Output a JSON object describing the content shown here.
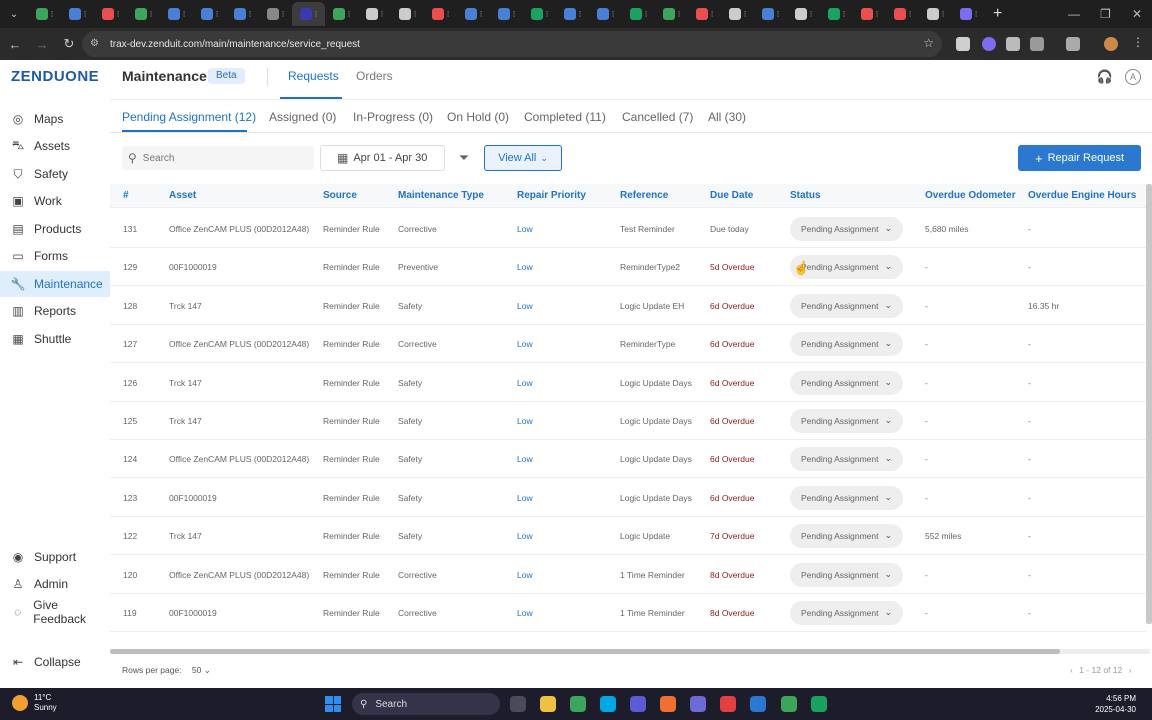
{
  "browser": {
    "url": "trax-dev.zenduit.com/main/maintenance/service_request",
    "favicon_colors": [
      "#3ba55c",
      "#4a7fd6",
      "#e94f4f",
      "#3ba55c",
      "#4a7fd6",
      "#4a7fd6",
      "#4a7fd6",
      "#888888",
      "#3a3ab0",
      "#3ba55c",
      "#cccccc",
      "#cccccc",
      "#e94f4f",
      "#4a7fd6",
      "#4a7fd6",
      "#1aa260",
      "#4a7fd6",
      "#4a7fd6",
      "#1aa260",
      "#3ba55c",
      "#e94f4f",
      "#cccccc",
      "#4a7fd6",
      "#cccccc",
      "#1aa260",
      "#e94f4f",
      "#e94f4f",
      "#cccccc",
      "#7b6cf0"
    ]
  },
  "app": {
    "logo": "ZENDUONE",
    "page_title": "Maintenance",
    "beta_badge": "Beta",
    "top_tabs": [
      "Requests",
      "Orders"
    ],
    "active_top_tab": "Requests"
  },
  "sidebar": {
    "items": [
      {
        "label": "Maps",
        "icon": "map-pin-icon"
      },
      {
        "label": "Assets",
        "icon": "car-icon"
      },
      {
        "label": "Safety",
        "icon": "shield-icon"
      },
      {
        "label": "Work",
        "icon": "briefcase-icon"
      },
      {
        "label": "Products",
        "icon": "box-icon"
      },
      {
        "label": "Forms",
        "icon": "form-icon"
      },
      {
        "label": "Maintenance",
        "icon": "wrench-icon"
      },
      {
        "label": "Reports",
        "icon": "chart-icon"
      },
      {
        "label": "Shuttle",
        "icon": "bus-icon"
      }
    ],
    "active": "Maintenance",
    "bottom": [
      {
        "label": "Support",
        "icon": "support-icon"
      },
      {
        "label": "Admin",
        "icon": "user-icon"
      },
      {
        "label": "Give Feedback",
        "icon": "feedback-icon"
      }
    ],
    "collapse_label": "Collapse"
  },
  "status_tabs": [
    "Pending Assignment (12)",
    "Assigned (0)",
    "In-Progress (0)",
    "On Hold (0)",
    "Completed (11)",
    "Cancelled (7)",
    "All (30)"
  ],
  "filters": {
    "search_placeholder": "Search",
    "date_range": "Apr 01 - Apr 30",
    "view_all_label": "View All",
    "repair_request_label": "Repair Request"
  },
  "table": {
    "columns": [
      "#",
      "Asset",
      "Source",
      "Maintenance Type",
      "Repair Priority",
      "Reference",
      "Due Date",
      "Status",
      "Overdue Odometer",
      "Overdue Engine Hours"
    ],
    "rows": [
      {
        "id": "131",
        "asset": "Office ZenCAM PLUS (00D2012A48)",
        "source": "Reminder Rule",
        "type": "Corrective",
        "priority": "Low",
        "reference": "Test Reminder",
        "due": "Due today",
        "due_overdue": false,
        "status": "Pending Assignment",
        "odometer": "5,680 miles",
        "engine_hours": "-"
      },
      {
        "id": "129",
        "asset": "00F1000019",
        "source": "Reminder Rule",
        "type": "Preventive",
        "priority": "Low",
        "reference": "ReminderType2",
        "due": "5d Overdue",
        "due_overdue": true,
        "status": "Pending Assignment",
        "odometer": "-",
        "engine_hours": "-"
      },
      {
        "id": "128",
        "asset": "Trck 147",
        "source": "Reminder Rule",
        "type": "Safety",
        "priority": "Low",
        "reference": "Logic Update EH",
        "due": "6d Overdue",
        "due_overdue": true,
        "status": "Pending Assignment",
        "odometer": "-",
        "engine_hours": "16.35 hr"
      },
      {
        "id": "127",
        "asset": "Office ZenCAM PLUS (00D2012A48)",
        "source": "Reminder Rule",
        "type": "Corrective",
        "priority": "Low",
        "reference": "ReminderType",
        "due": "6d Overdue",
        "due_overdue": true,
        "status": "Pending Assignment",
        "odometer": "-",
        "engine_hours": "-"
      },
      {
        "id": "126",
        "asset": "Trck 147",
        "source": "Reminder Rule",
        "type": "Safety",
        "priority": "Low",
        "reference": "Logic Update Days",
        "due": "6d Overdue",
        "due_overdue": true,
        "status": "Pending Assignment",
        "odometer": "-",
        "engine_hours": "-"
      },
      {
        "id": "125",
        "asset": "Trck 147",
        "source": "Reminder Rule",
        "type": "Safety",
        "priority": "Low",
        "reference": "Logic Update Days",
        "due": "6d Overdue",
        "due_overdue": true,
        "status": "Pending Assignment",
        "odometer": "-",
        "engine_hours": "-"
      },
      {
        "id": "124",
        "asset": "Office ZenCAM PLUS (00D2012A48)",
        "source": "Reminder Rule",
        "type": "Safety",
        "priority": "Low",
        "reference": "Logic Update Days",
        "due": "6d Overdue",
        "due_overdue": true,
        "status": "Pending Assignment",
        "odometer": "-",
        "engine_hours": "-"
      },
      {
        "id": "123",
        "asset": "00F1000019",
        "source": "Reminder Rule",
        "type": "Safety",
        "priority": "Low",
        "reference": "Logic Update Days",
        "due": "6d Overdue",
        "due_overdue": true,
        "status": "Pending Assignment",
        "odometer": "-",
        "engine_hours": "-"
      },
      {
        "id": "122",
        "asset": "Trck 147",
        "source": "Reminder Rule",
        "type": "Safety",
        "priority": "Low",
        "reference": "Logic Update",
        "due": "7d Overdue",
        "due_overdue": true,
        "status": "Pending Assignment",
        "odometer": "552 miles",
        "engine_hours": "-"
      },
      {
        "id": "120",
        "asset": "Office ZenCAM PLUS (00D2012A48)",
        "source": "Reminder Rule",
        "type": "Corrective",
        "priority": "Low",
        "reference": "1 Time Reminder",
        "due": "8d Overdue",
        "due_overdue": true,
        "status": "Pending Assignment",
        "odometer": "-",
        "engine_hours": "-"
      },
      {
        "id": "119",
        "asset": "00F1000019",
        "source": "Reminder Rule",
        "type": "Corrective",
        "priority": "Low",
        "reference": "1 Time Reminder",
        "due": "8d Overdue",
        "due_overdue": true,
        "status": "Pending Assignment",
        "odometer": "-",
        "engine_hours": "-"
      }
    ]
  },
  "footer": {
    "rows_per_page_label": "Rows per page:",
    "rows_per_page_value": "50",
    "page_count": "1 - 12 of 12"
  },
  "taskbar": {
    "temperature": "11°C",
    "weather": "Sunny",
    "search_label": "Search",
    "time": "4:56 PM",
    "date": "2025-04-30",
    "app_colors": [
      "#4a4a5a",
      "#f0c040",
      "#3ba55c",
      "#00a8e8",
      "#5b5bd6",
      "#f07030",
      "#6b6bd6",
      "#e04040",
      "#2a78d0",
      "#3ba55c",
      "#1aa260"
    ]
  },
  "colors": {
    "accent": "#1e73c8",
    "overdue": "#8b1d1d",
    "active_nav_bg": "#dfeefc"
  }
}
